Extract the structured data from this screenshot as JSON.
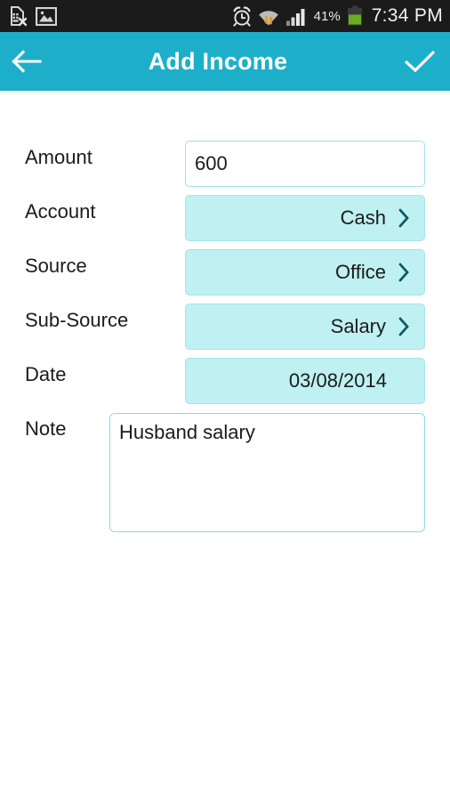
{
  "statusbar": {
    "left_icons": [
      "sim-card-error-icon",
      "image-icon"
    ],
    "right_icons": [
      "alarm-clock-icon",
      "wifi-transfer-icon",
      "cellular-signal-icon"
    ],
    "battery_percent": "41%",
    "battery_icon": "battery-icon",
    "clock": "7:34 PM"
  },
  "actionbar": {
    "back_icon": "back-arrow-icon",
    "title": "Add Income",
    "done_icon": "checkmark-icon"
  },
  "form": {
    "fields": [
      {
        "label": "Amount",
        "value": "600",
        "type": "input",
        "chevron": false
      },
      {
        "label": "Account",
        "value": "Cash",
        "type": "select",
        "chevron": true
      },
      {
        "label": "Source",
        "value": "Office",
        "type": "select",
        "chevron": true
      },
      {
        "label": "Sub-Source",
        "value": "Salary",
        "type": "select",
        "chevron": true
      },
      {
        "label": "Date",
        "value": "03/08/2014",
        "type": "date",
        "chevron": false
      }
    ],
    "note": {
      "label": "Note",
      "value": "Husband salary"
    }
  },
  "colors": {
    "accent": "#1dafc9",
    "field_fill": "#bff0f2",
    "field_border": "#9fdfe8",
    "chevron": "#0d5963",
    "statusbar_bg": "#1b1b1b",
    "battery_green": "#6aad1f"
  }
}
